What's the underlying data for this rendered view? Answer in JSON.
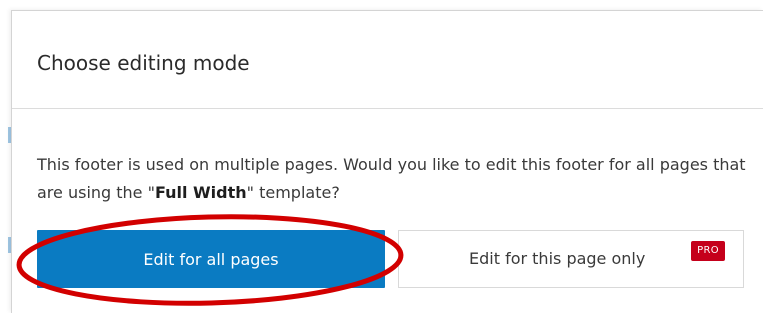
{
  "dialog": {
    "title": "Choose editing mode",
    "message_prefix": "This footer is used on multiple pages. Would you like to edit this footer for all pages that are using the \"",
    "template_name": "Full Width",
    "message_suffix": "\" template?"
  },
  "buttons": {
    "edit_all_label": "Edit for all pages",
    "edit_this_label": "Edit for this page only",
    "pro_badge": "PRO"
  },
  "colors": {
    "primary_button": "#0a7bc2",
    "pro_badge": "#c5001b",
    "annotation_circle": "#d20000"
  }
}
